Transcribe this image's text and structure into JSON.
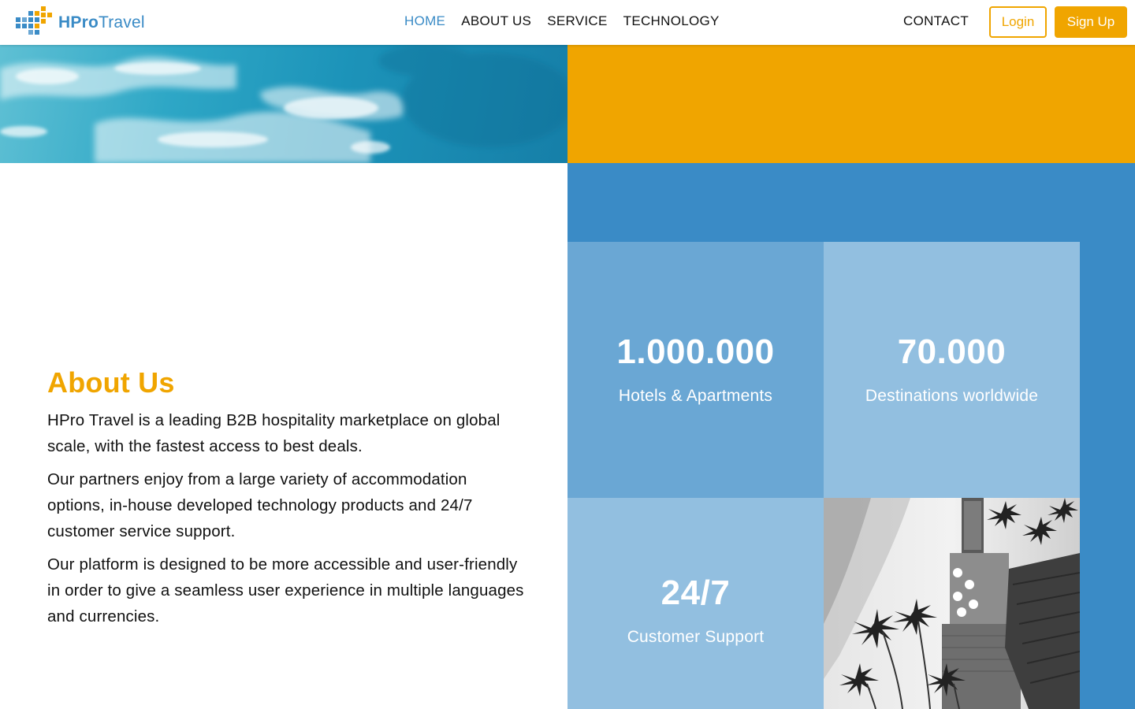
{
  "brand": {
    "name_bold": "HPro",
    "name_light": "Travel",
    "colors": {
      "blue": "#3a8bc6",
      "orange": "#f0a500"
    }
  },
  "nav": {
    "items": [
      {
        "label": "HOME",
        "active": true
      },
      {
        "label": "ABOUT US",
        "active": false
      },
      {
        "label": "SERVICE",
        "active": false
      },
      {
        "label": "TECHNOLOGY",
        "active": false
      }
    ],
    "contact": "CONTACT",
    "login": "Login",
    "signup": "Sign Up"
  },
  "about": {
    "heading": "About Us",
    "paragraphs": [
      "HPro Travel is a leading B2B hospitality marketplace on global scale, with the fastest access to best deals.",
      "Our partners enjoy from a large variety of accommodation options, in-house developed technology products and 24/7 customer service support.",
      "Our platform is designed to be more accessible and user-friendly in order to give a seamless user experience in multiple languages and currencies."
    ]
  },
  "stats": [
    {
      "value": "1.000.000",
      "label": "Hotels & Apartments"
    },
    {
      "value": "70.000",
      "label": "Destinations worldwide"
    },
    {
      "value": "24/7",
      "label": "Customer Support"
    }
  ],
  "images": {
    "hero": "ocean-waves-photo",
    "tile": "beach-resort-aerial-photo"
  }
}
